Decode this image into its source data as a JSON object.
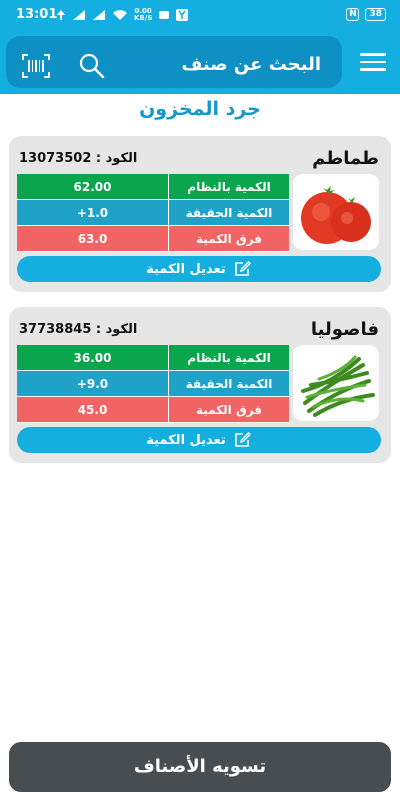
{
  "status_bar": {
    "time": "13:01",
    "net_speed_value": "0.00",
    "net_speed_unit": "KB/S",
    "battery": "38"
  },
  "header": {
    "title": "البحث عن صنف"
  },
  "page_title": "جرد المخزون",
  "items": [
    {
      "name": "طماطم",
      "code_label": "الكود :",
      "code": "13073502",
      "rows": [
        {
          "label": "الكمية بالنظام",
          "value": "62.00"
        },
        {
          "label": "الكمية الحقيقة",
          "value": "+1.0"
        },
        {
          "label": "فرق الكمية",
          "value": "63.0"
        }
      ],
      "edit_label": "تعديل الكمية"
    },
    {
      "name": "فاصوليا",
      "code_label": "الكود :",
      "code": "37738845",
      "rows": [
        {
          "label": "الكمية بالنظام",
          "value": "36.00"
        },
        {
          "label": "الكمية الحقيقة",
          "value": "+9.0"
        },
        {
          "label": "فرق الكمية",
          "value": "45.0"
        }
      ],
      "edit_label": "تعديل الكمية"
    }
  ],
  "settle_button": "تسويه الأصناف",
  "colors": {
    "accent": "#14aee0",
    "header_pill": "#0e90c4",
    "row_system": "#0aa54c",
    "row_actual": "#1ea2c8",
    "row_diff": "#f26363",
    "bottom_button": "#484d52"
  },
  "icons": [
    "barcode-scan-icon",
    "search-icon",
    "menu-icon",
    "edit-icon"
  ]
}
